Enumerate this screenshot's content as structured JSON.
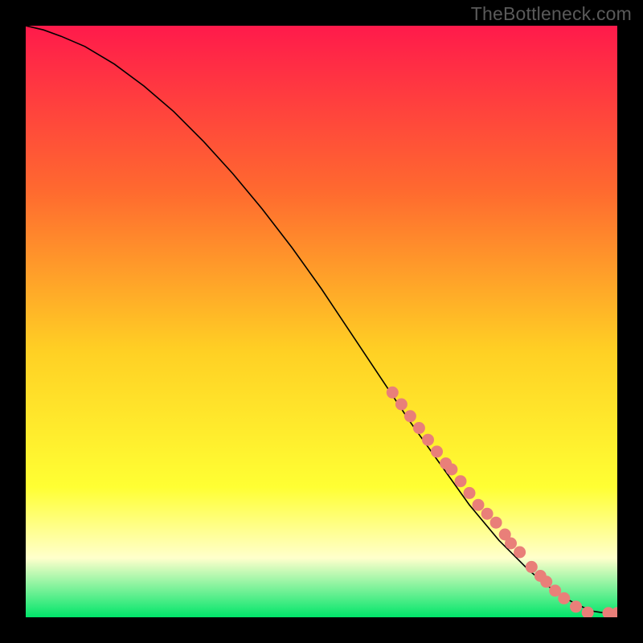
{
  "watermark": "TheBottleneck.com",
  "colors": {
    "frame": "#000000",
    "grad_top": "#ff1a4b",
    "grad_mid1": "#ff6a2f",
    "grad_mid2": "#ffd024",
    "grad_mid3": "#ffff33",
    "grad_pale": "#ffffcc",
    "grad_bottom": "#00e56a",
    "curve": "#000000",
    "dot_fill": "#e97f79",
    "dot_stroke": "#b85c56"
  },
  "chart_data": {
    "type": "line",
    "title": "",
    "xlabel": "",
    "ylabel": "",
    "xlim": [
      0,
      100
    ],
    "ylim": [
      0,
      100
    ],
    "series": [
      {
        "name": "curve",
        "x": [
          0,
          3,
          6,
          10,
          15,
          20,
          25,
          30,
          35,
          40,
          45,
          50,
          55,
          60,
          65,
          70,
          75,
          80,
          85,
          88,
          90,
          92,
          94,
          96,
          98,
          100
        ],
        "y": [
          100,
          99.3,
          98.2,
          96.5,
          93.5,
          89.8,
          85.5,
          80.5,
          75.0,
          69.0,
          62.5,
          55.5,
          48.0,
          40.5,
          33.0,
          26.0,
          19.0,
          13.0,
          8.0,
          5.5,
          4.0,
          2.8,
          1.8,
          1.0,
          0.7,
          0.7
        ]
      }
    ],
    "points": [
      {
        "x": 62,
        "y": 38
      },
      {
        "x": 63.5,
        "y": 36
      },
      {
        "x": 65,
        "y": 34
      },
      {
        "x": 66.5,
        "y": 32
      },
      {
        "x": 68,
        "y": 30
      },
      {
        "x": 69.5,
        "y": 28
      },
      {
        "x": 71,
        "y": 26
      },
      {
        "x": 72,
        "y": 25
      },
      {
        "x": 73.5,
        "y": 23
      },
      {
        "x": 75,
        "y": 21
      },
      {
        "x": 76.5,
        "y": 19
      },
      {
        "x": 78,
        "y": 17.5
      },
      {
        "x": 79.5,
        "y": 16
      },
      {
        "x": 81,
        "y": 14
      },
      {
        "x": 82,
        "y": 12.5
      },
      {
        "x": 83.5,
        "y": 11
      },
      {
        "x": 85.5,
        "y": 8.5
      },
      {
        "x": 87,
        "y": 7
      },
      {
        "x": 88,
        "y": 6
      },
      {
        "x": 89.5,
        "y": 4.5
      },
      {
        "x": 91,
        "y": 3.2
      },
      {
        "x": 93,
        "y": 1.8
      },
      {
        "x": 95,
        "y": 0.8
      },
      {
        "x": 98.5,
        "y": 0.7
      },
      {
        "x": 100,
        "y": 0.7
      }
    ]
  }
}
